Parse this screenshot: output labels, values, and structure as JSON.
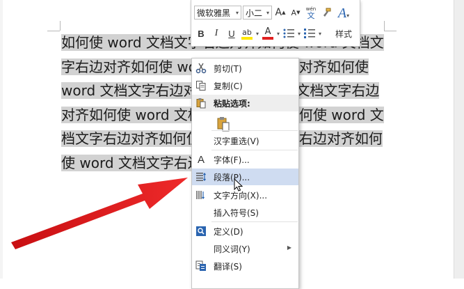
{
  "document": {
    "lines": [
      "如何使 word 文档文字右边对齐如何使 word 文档文",
      "字右边对齐如何使 word 文档文字右边对齐如何使",
      "word 文档文字右边对齐如何使 word 文档文字右边",
      "对齐如何使 word 文档文字右边对齐如何使 word 文",
      "档文字右边对齐如何使 word 文档文字右边对齐如何",
      "使 word 文档文字右边对齐"
    ]
  },
  "mini_toolbar": {
    "font_name": "微软雅黑",
    "font_size": "小二",
    "grow_font": "A",
    "shrink_font": "A",
    "phonetic": "wén",
    "bold": "B",
    "italic": "I",
    "underline": "U",
    "highlight": "ab",
    "font_color": "A",
    "styles_label": "样式",
    "styles_glyph": "A"
  },
  "context_menu": {
    "cut": "剪切(T)",
    "copy": "复制(C)",
    "paste_options": "粘贴选项:",
    "hanzi_reselect": "汉字重选(V)",
    "font": "字体(F)...",
    "paragraph": "段落(P)...",
    "text_direction": "文字方向(X)...",
    "insert_symbol": "插入符号(S)",
    "define": "定义(D)",
    "synonyms": "同义词(Y)",
    "translate": "翻译(S)",
    "font_icon_glyph": "A"
  },
  "colors": {
    "selection": "#d2d2d2",
    "menu_highlight": "#cfdcf1",
    "arrow": "#e0191c",
    "highlight_yellow": "#ffe800",
    "font_red": "#e02020"
  }
}
